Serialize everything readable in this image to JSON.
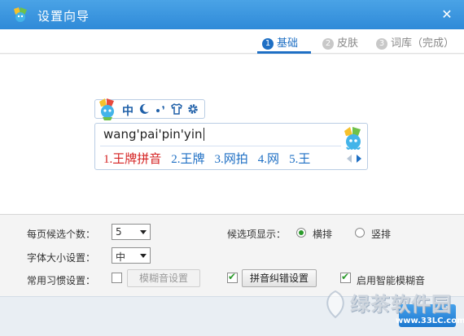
{
  "window": {
    "title": "设置向导",
    "close_glyph": "✕"
  },
  "steps": [
    {
      "num": "1",
      "label": "基础",
      "active": true
    },
    {
      "num": "2",
      "label": "皮肤",
      "active": false
    },
    {
      "num": "3",
      "label": "词库（完成）",
      "active": false
    }
  ],
  "toolbar": {
    "zh_label": "中",
    "icons": [
      "moon-icon",
      "punctuation-icon",
      "shirt-icon",
      "gear-icon"
    ]
  },
  "candidates": {
    "pinyin": "wang'pai'pin'yin",
    "items": [
      "1.王牌拼音",
      "2.王牌",
      "3.网拍",
      "4.网",
      "5.王"
    ]
  },
  "settings": {
    "per_page_label": "每页候选个数：",
    "per_page_value": "5",
    "font_size_label": "字体大小设置：",
    "font_size_value": "中",
    "habit_label": "常用习惯设置：",
    "fuzzy_button": "模糊音设置",
    "correction_button": "拼音纠错设置",
    "smart_fuzzy_label": "启用智能模糊音",
    "display_label": "候选项显示：",
    "horizontal_label": "横排",
    "vertical_label": "竖排"
  },
  "watermark": {
    "text": "绿茶软件园",
    "url": "www.33LC.com"
  },
  "colors": {
    "accent": "#1e6fc4",
    "titlebar": "#3a95dd",
    "first_candidate": "#d42020",
    "check": "#2a9a2a"
  }
}
